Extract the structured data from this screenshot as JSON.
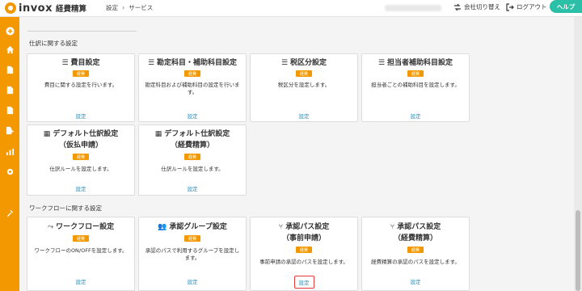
{
  "header": {
    "logo_text": "invox",
    "product_name": "経費精算",
    "breadcrumb": [
      "設定",
      "サービス"
    ],
    "breadcrumb_sep": "›",
    "switch_company": "会社切り替え",
    "logout": "ログアウト",
    "help": "ヘルプ"
  },
  "sidebar": {
    "icons": [
      "plus-circle-icon",
      "home-icon",
      "document-icon",
      "document-icon",
      "document-icon",
      "document-export-icon",
      "chart-icon",
      "gear-icon",
      "tools-icon"
    ]
  },
  "sections": [
    {
      "title": "仕訳に関する設定",
      "cards": [
        {
          "title": "費目設定",
          "icon": "list-icon",
          "badge": "経費",
          "desc": "費目に関する設定を行います。",
          "link": "設定"
        },
        {
          "title": "勘定科目・補助科目設定",
          "icon": "list-icon",
          "badge": "経費",
          "desc": "勘定科目および補助科目の設定を行います。",
          "link": "設定"
        },
        {
          "title": "税区分設定",
          "icon": "list-icon",
          "badge": "経費",
          "desc": "税区分を設定します。",
          "link": "設定"
        },
        {
          "title": "担当者補助科目設定",
          "icon": "list-icon",
          "badge": "経費",
          "desc": "担当者ごとの補助科目を設定します。",
          "link": "設定"
        },
        {
          "title": "デフォルト仕訳設定",
          "title2": "（仮払申請）",
          "icon": "table-icon",
          "badge": "経費",
          "desc": "仕訳ルールを設定します。",
          "link": "設定"
        },
        {
          "title": "デフォルト仕訳設定",
          "title2": "（経費精算）",
          "icon": "table-icon",
          "badge": "経費",
          "desc": "仕訳ルールを設定します。",
          "link": "設定"
        }
      ]
    },
    {
      "title": "ワークフローに関する設定",
      "cards": [
        {
          "title": "ワークフロー設定",
          "icon": "flow-icon",
          "badge": "経費",
          "desc": "ワークフローのON/OFFを設定します。",
          "link": "設定"
        },
        {
          "title": "承認グループ設定",
          "icon": "users-icon",
          "badge": "経費",
          "desc": "承認のパスで利用するグループを設定します。",
          "link": "設定"
        },
        {
          "title": "承認パス設定",
          "title2": "（事前申請）",
          "icon": "route-icon",
          "badge": "経費",
          "desc": "事前申請の承認のパスを設定します。",
          "link": "設定"
        },
        {
          "title": "承認パス設定",
          "title2": "（経費精算）",
          "icon": "route-icon",
          "badge": "経費",
          "desc": "経費精算の承認のパスを設定します。",
          "link": "設定"
        }
      ]
    }
  ],
  "colors": {
    "brand": "#f39800",
    "help": "#2bbfa8",
    "link": "#2a8fbd",
    "highlight": "#e53935"
  }
}
